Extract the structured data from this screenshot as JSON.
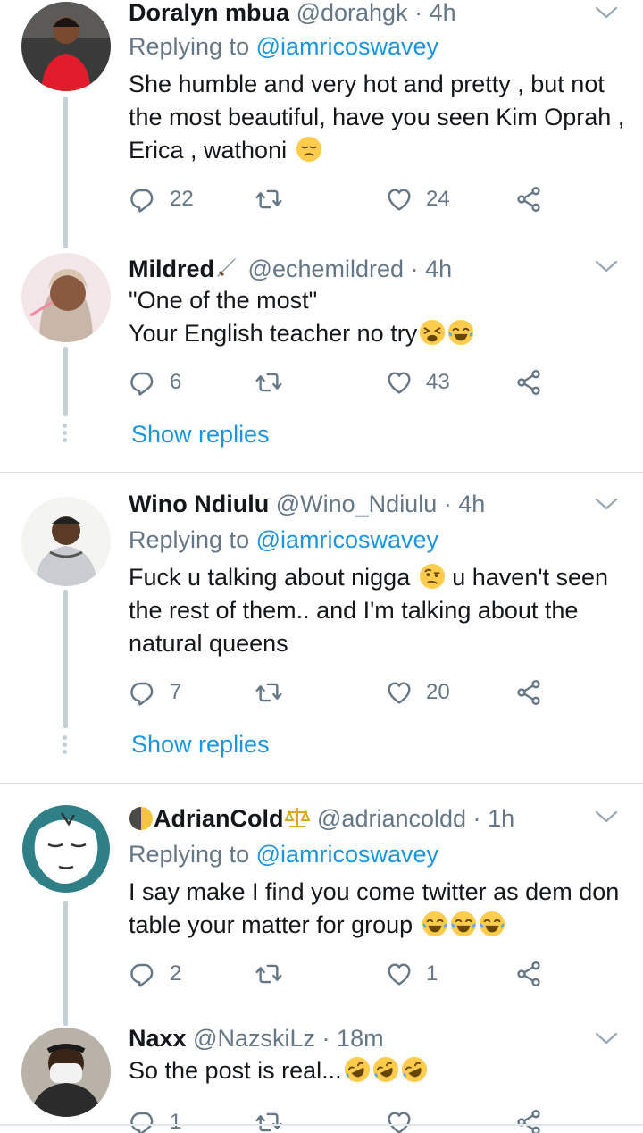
{
  "tweets": [
    {
      "name": "Doralyn mbua",
      "handle": "@dorahgk",
      "time": "4h",
      "replying_prefix": "Replying to",
      "replying_to": "@iamricoswavey",
      "text": "She humble and very hot and pretty , but not the most beautiful, have you seen Kim Oprah , Erica , wathoni",
      "replies": "22",
      "retweets": "",
      "likes": "24"
    },
    {
      "name": "Mildred",
      "handle": "@echemildred",
      "time": "4h",
      "text_line1": "\"One of the most\"",
      "text_line2": "Your English teacher no try",
      "replies": "6",
      "retweets": "",
      "likes": "43",
      "show_replies": "Show replies"
    },
    {
      "name": "Wino Ndiulu",
      "handle": "@Wino_Ndiulu",
      "time": "4h",
      "replying_prefix": "Replying to",
      "replying_to": "@iamricoswavey",
      "text_a": "Fuck u talking about nigga",
      "text_b": "u haven't seen the rest of them.. and I'm talking about the natural queens",
      "replies": "7",
      "retweets": "",
      "likes": "20",
      "show_replies": "Show replies"
    },
    {
      "name": "AdrianCold",
      "handle": "@adriancoldd",
      "time": "1h",
      "replying_prefix": "Replying to",
      "replying_to": "@iamricoswavey",
      "text": "I say make I find you come twitter as dem don table your matter for group",
      "replies": "2",
      "retweets": "",
      "likes": "1"
    },
    {
      "name": "Naxx",
      "handle": "@NazskiLz",
      "time": "18m",
      "text": "So the post is real...",
      "replies": "1",
      "retweets": "",
      "likes": ""
    }
  ],
  "separator": "·",
  "colors": {
    "link": "#1b95e0",
    "muted": "#657786",
    "thread": "#c4cfd6"
  }
}
